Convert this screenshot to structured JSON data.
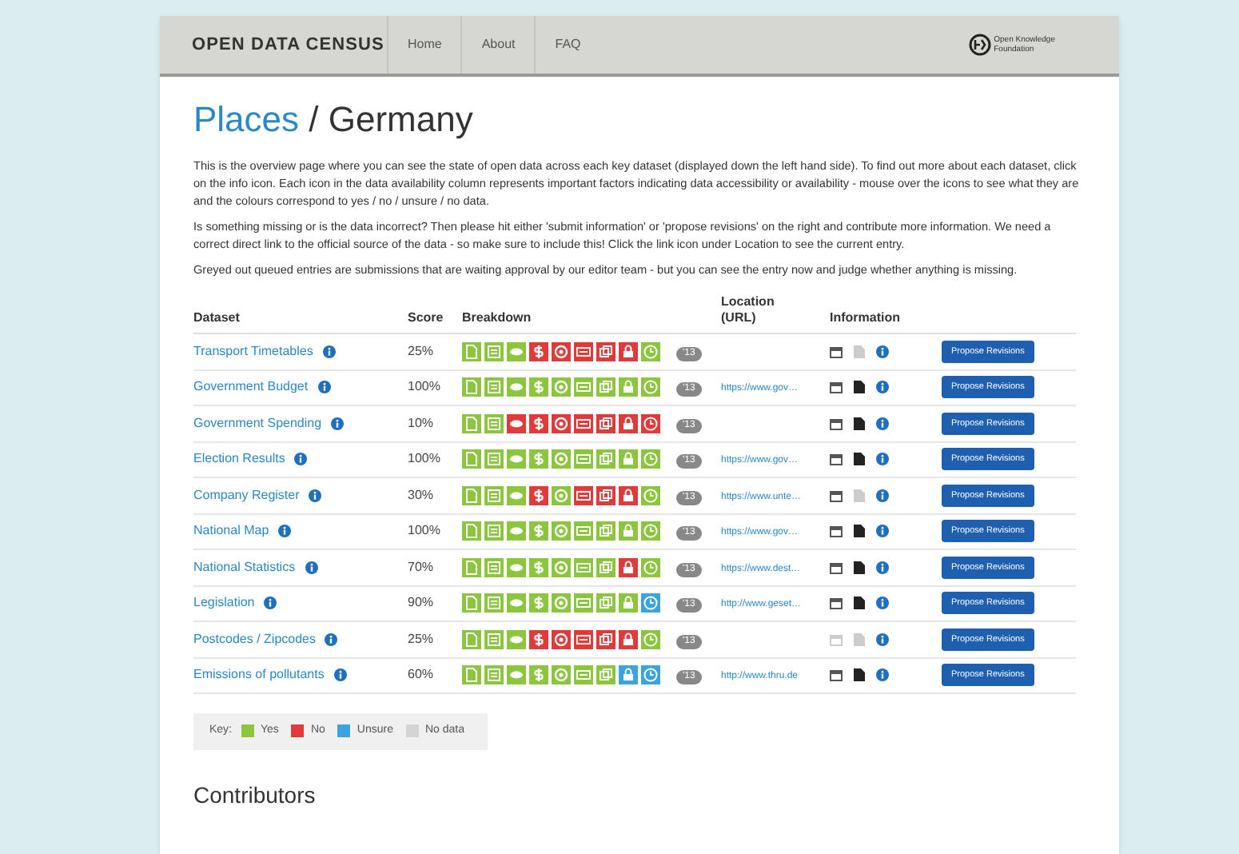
{
  "header": {
    "brand": "OPEN DATA CENSUS",
    "nav": [
      {
        "label": "Home"
      },
      {
        "label": "About"
      },
      {
        "label": "FAQ"
      }
    ],
    "partner_logo": {
      "line1": "Open Knowledge",
      "line2": "Foundation"
    }
  },
  "breadcrumb": {
    "link": "Places",
    "separator": " / ",
    "current": "Germany"
  },
  "intro": [
    "This is the overview page where you can see the state of open data across each key dataset (displayed down the left hand side). To find out more about each dataset, click on the info icon. Each icon in the data availability column represents important factors indicating data accessibility or availability - mouse over the icons to see what they are and the colours correspond to yes / no / unsure / no data.",
    "Is something missing or is the data incorrect? Then please hit either 'submit information' or 'propose revisions' on the right and contribute more information. We need a correct direct link to the official source of the data - so make sure to include this! Click the link icon under Location to see the current entry.",
    "Greyed out queued entries are submissions that are waiting approval by our editor team - but you can see the entry now and judge whether anything is missing."
  ],
  "table": {
    "columns": [
      "Dataset",
      "Score",
      "Breakdown",
      "Location (URL)",
      "Information"
    ],
    "rows": [
      {
        "dataset": "Transport Timetables",
        "score": "25%",
        "breakdown": [
          {
            "color": "#8cc63f"
          },
          {
            "color": "#8cc63f"
          },
          {
            "color": "#8cc63f"
          },
          {
            "color": "#e03a3a"
          },
          {
            "color": "#e03a3a"
          },
          {
            "color": "#e03a3a"
          },
          {
            "color": "#e03a3a"
          },
          {
            "color": "#e03a3a"
          },
          {
            "color": "#8cc63f"
          }
        ],
        "year": "'13",
        "url": "",
        "calendar_available": true,
        "document_available": false,
        "action": "Propose Revisions"
      },
      {
        "dataset": "Government Budget",
        "score": "100%",
        "breakdown": [
          {
            "color": "#8cc63f"
          },
          {
            "color": "#8cc63f"
          },
          {
            "color": "#8cc63f"
          },
          {
            "color": "#8cc63f"
          },
          {
            "color": "#8cc63f"
          },
          {
            "color": "#8cc63f"
          },
          {
            "color": "#8cc63f"
          },
          {
            "color": "#8cc63f"
          },
          {
            "color": "#8cc63f"
          }
        ],
        "year": "'13",
        "url": "https://www.gov…",
        "calendar_available": true,
        "document_available": true,
        "action": "Propose Revisions"
      },
      {
        "dataset": "Government Spending",
        "score": "10%",
        "breakdown": [
          {
            "color": "#8cc63f"
          },
          {
            "color": "#8cc63f"
          },
          {
            "color": "#e03a3a"
          },
          {
            "color": "#e03a3a"
          },
          {
            "color": "#e03a3a"
          },
          {
            "color": "#e03a3a"
          },
          {
            "color": "#e03a3a"
          },
          {
            "color": "#e03a3a"
          },
          {
            "color": "#e03a3a"
          }
        ],
        "year": "'13",
        "url": "",
        "calendar_available": true,
        "document_available": true,
        "action": "Propose Revisions"
      },
      {
        "dataset": "Election Results",
        "score": "100%",
        "breakdown": [
          {
            "color": "#8cc63f"
          },
          {
            "color": "#8cc63f"
          },
          {
            "color": "#8cc63f"
          },
          {
            "color": "#8cc63f"
          },
          {
            "color": "#8cc63f"
          },
          {
            "color": "#8cc63f"
          },
          {
            "color": "#8cc63f"
          },
          {
            "color": "#8cc63f"
          },
          {
            "color": "#8cc63f"
          }
        ],
        "year": "'13",
        "url": "https://www.gov…",
        "calendar_available": true,
        "document_available": true,
        "action": "Propose Revisions"
      },
      {
        "dataset": "Company Register",
        "score": "30%",
        "breakdown": [
          {
            "color": "#8cc63f"
          },
          {
            "color": "#8cc63f"
          },
          {
            "color": "#8cc63f"
          },
          {
            "color": "#e03a3a"
          },
          {
            "color": "#8cc63f"
          },
          {
            "color": "#e03a3a"
          },
          {
            "color": "#e03a3a"
          },
          {
            "color": "#e03a3a"
          },
          {
            "color": "#8cc63f"
          }
        ],
        "year": "'13",
        "url": "https://www.unte…",
        "calendar_available": true,
        "document_available": false,
        "action": "Propose Revisions"
      },
      {
        "dataset": "National Map",
        "score": "100%",
        "breakdown": [
          {
            "color": "#8cc63f"
          },
          {
            "color": "#8cc63f"
          },
          {
            "color": "#8cc63f"
          },
          {
            "color": "#8cc63f"
          },
          {
            "color": "#8cc63f"
          },
          {
            "color": "#8cc63f"
          },
          {
            "color": "#8cc63f"
          },
          {
            "color": "#8cc63f"
          },
          {
            "color": "#8cc63f"
          }
        ],
        "year": "'13",
        "url": "https://www.gov…",
        "calendar_available": true,
        "document_available": true,
        "action": "Propose Revisions"
      },
      {
        "dataset": "National Statistics",
        "score": "70%",
        "breakdown": [
          {
            "color": "#8cc63f"
          },
          {
            "color": "#8cc63f"
          },
          {
            "color": "#8cc63f"
          },
          {
            "color": "#8cc63f"
          },
          {
            "color": "#8cc63f"
          },
          {
            "color": "#8cc63f"
          },
          {
            "color": "#8cc63f"
          },
          {
            "color": "#e03a3a"
          },
          {
            "color": "#8cc63f"
          }
        ],
        "year": "'13",
        "url": "https://www.dest…",
        "calendar_available": true,
        "document_available": true,
        "action": "Propose Revisions"
      },
      {
        "dataset": "Legislation",
        "score": "90%",
        "breakdown": [
          {
            "color": "#8cc63f"
          },
          {
            "color": "#8cc63f"
          },
          {
            "color": "#8cc63f"
          },
          {
            "color": "#8cc63f"
          },
          {
            "color": "#8cc63f"
          },
          {
            "color": "#8cc63f"
          },
          {
            "color": "#8cc63f"
          },
          {
            "color": "#8cc63f"
          },
          {
            "color": "#3aa3e0"
          }
        ],
        "year": "'13",
        "url": "http://www.geset…",
        "calendar_available": true,
        "document_available": true,
        "action": "Propose Revisions"
      },
      {
        "dataset": "Postcodes / Zipcodes",
        "score": "25%",
        "breakdown": [
          {
            "color": "#8cc63f"
          },
          {
            "color": "#8cc63f"
          },
          {
            "color": "#8cc63f"
          },
          {
            "color": "#e03a3a"
          },
          {
            "color": "#e03a3a"
          },
          {
            "color": "#e03a3a"
          },
          {
            "color": "#e03a3a"
          },
          {
            "color": "#e03a3a"
          },
          {
            "color": "#8cc63f"
          }
        ],
        "year": "'13",
        "url": "",
        "calendar_available": false,
        "document_available": false,
        "action": "Propose Revisions"
      },
      {
        "dataset": "Emissions of pollutants",
        "score": "60%",
        "breakdown": [
          {
            "color": "#8cc63f"
          },
          {
            "color": "#8cc63f"
          },
          {
            "color": "#8cc63f"
          },
          {
            "color": "#8cc63f"
          },
          {
            "color": "#8cc63f"
          },
          {
            "color": "#8cc63f"
          },
          {
            "color": "#8cc63f"
          },
          {
            "color": "#3aa3e0"
          },
          {
            "color": "#3aa3e0"
          }
        ],
        "year": "'13",
        "url": "http://www.thru.de",
        "calendar_available": true,
        "document_available": true,
        "action": "Propose Revisions"
      }
    ]
  },
  "key": {
    "label": "Key:",
    "items": [
      {
        "label": "Yes",
        "color": "#8cc63f"
      },
      {
        "label": "No",
        "color": "#e03a3a"
      },
      {
        "label": "Unsure",
        "color": "#3aa3e0"
      },
      {
        "label": "No data",
        "color": "#d4d4d4"
      }
    ]
  },
  "contributors_heading": "Contributors"
}
